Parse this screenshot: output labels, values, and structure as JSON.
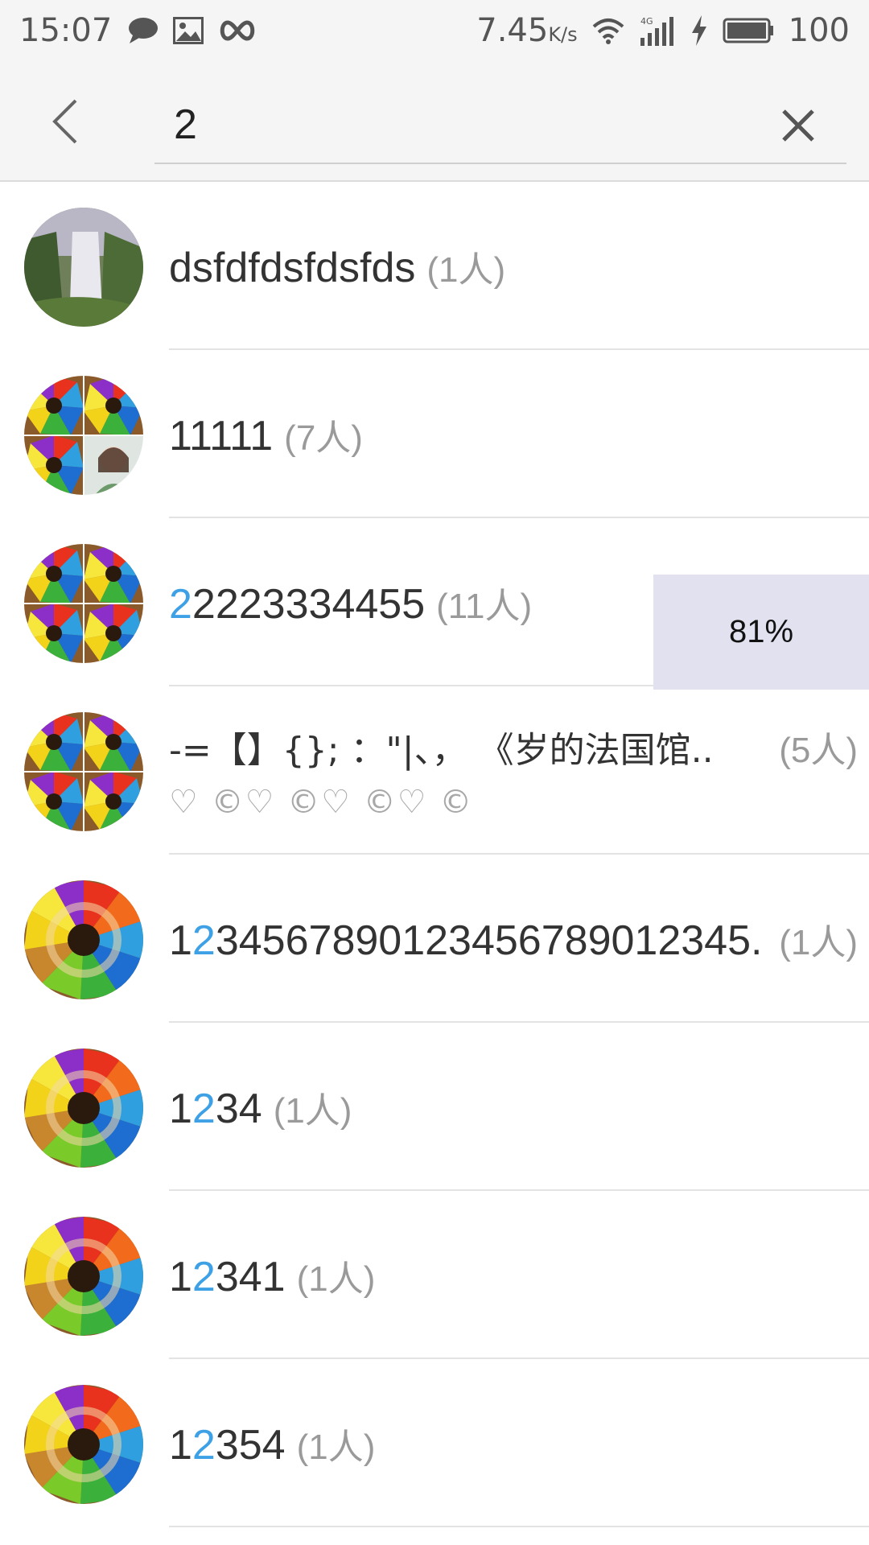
{
  "status_bar": {
    "time": "15:07",
    "speed": "7.45",
    "speed_unit": "K/s",
    "network": "4G",
    "battery": "100",
    "icons": [
      "chat-bubble-icon",
      "image-icon",
      "infinity-icon",
      "wifi-icon",
      "signal-icon",
      "charging-icon",
      "battery-icon"
    ]
  },
  "search": {
    "value": "2",
    "back_icon": "chevron-left-icon",
    "clear_icon": "close-icon"
  },
  "accent_color": "#3ea1e6",
  "results": [
    {
      "name_pre": "dsfdfdsfdsfds",
      "name_hl": "",
      "name_post": "",
      "count": "(1人)",
      "avatar": "waterfall"
    },
    {
      "name_pre": "11111",
      "name_hl": "",
      "name_post": "",
      "count": "(7人)",
      "avatar": "grid-with-photo"
    },
    {
      "name_pre": "",
      "name_hl": "2",
      "name_post": "2223334455",
      "count": "(11人)",
      "avatar": "grid"
    },
    {
      "name_pre": "-=【】{}; ：\"|、， 《岁的法国馆..",
      "name_hl": "",
      "name_post": "",
      "count": "(5人)",
      "sub": "♡ ©♡ ©♡ ©♡ ©",
      "avatar": "grid"
    },
    {
      "name_pre": "1",
      "name_hl": "2",
      "name_post": "34567890123456789012345..",
      "count": "(1人)",
      "avatar": "pencils"
    },
    {
      "name_pre": "1",
      "name_hl": "2",
      "name_post": "34",
      "count": "(1人)",
      "avatar": "pencils"
    },
    {
      "name_pre": "1",
      "name_hl": "2",
      "name_post": "341",
      "count": "(1人)",
      "avatar": "pencils"
    },
    {
      "name_pre": "1",
      "name_hl": "2",
      "name_post": "354",
      "count": "(1人)",
      "avatar": "pencils"
    }
  ],
  "overlay": {
    "progress_label": "81%"
  }
}
